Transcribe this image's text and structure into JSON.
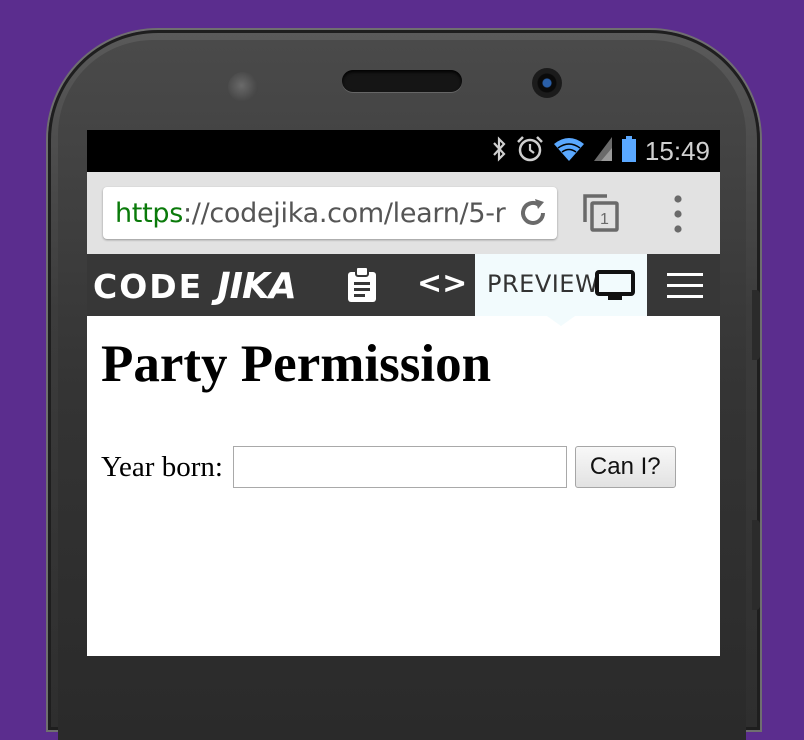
{
  "statusbar": {
    "time": "15:49",
    "icons": [
      "bluetooth-icon",
      "alarm-icon",
      "wifi-icon",
      "signal-icon",
      "battery-icon"
    ]
  },
  "browser": {
    "url_scheme": "https",
    "url_rest": "://codejika.com/learn/5-r",
    "tab_count": "1"
  },
  "app_nav": {
    "logo_code": "CODE",
    "logo_jika": "JIKA",
    "code_symbol": "<>",
    "preview_label": "PREVIEW",
    "icons": [
      "clipboard-icon",
      "code-icon",
      "monitor-icon",
      "hamburger-icon"
    ]
  },
  "preview": {
    "title": "Party Permission",
    "year_label": "Year born:",
    "year_value": "",
    "button_label": "Can I?"
  },
  "colors": {
    "background": "#5b2d8e",
    "url_https": "#0a7a0a",
    "time": "#5aa8ff",
    "nav_bg": "#373737",
    "preview_tab_bg": "#f2fbfd"
  }
}
